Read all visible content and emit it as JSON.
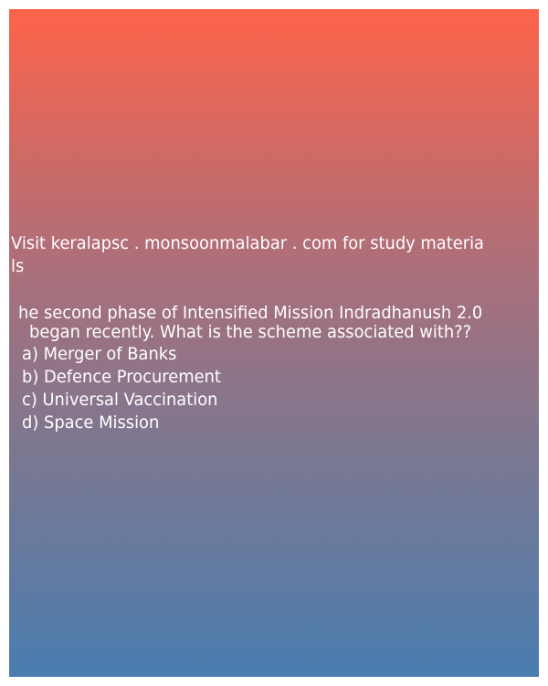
{
  "ad": {
    "line1": "Visit keralapsc . monsoonmalabar . com for study materia",
    "line2": "ls"
  },
  "question": {
    "line1": "he second phase of Intensified Mission Indradhanush 2.0",
    "line2": "began recently. What is the scheme associated with??"
  },
  "options": [
    "a) Merger of Banks",
    "b) Defence Procurement",
    "c) Universal Vaccination",
    "d) Space Mission"
  ]
}
